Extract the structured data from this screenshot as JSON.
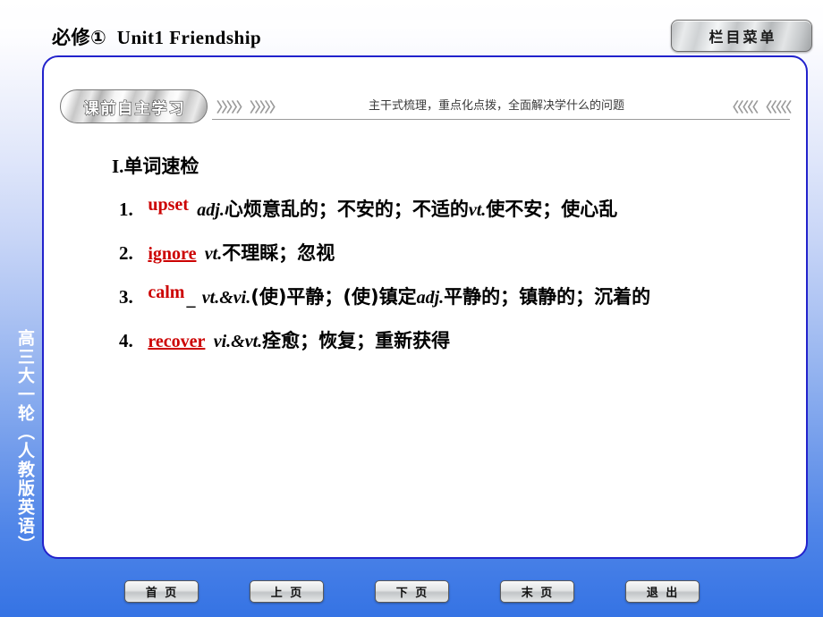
{
  "header": {
    "book_volume": "必修①",
    "unit_title": "Unit1 Friendship",
    "menu_button": "栏目菜单"
  },
  "sidebar": {
    "vertical_label": "高三大一轮（人教版英语）"
  },
  "section": {
    "badge": "课前自主学习",
    "chevrons_left": "〉〉〉〉〉 〉〉〉〉〉",
    "chevrons_right": "〈〈〈〈〈 〈〈〈〈〈",
    "caption": "主干式梳理，重点化点拨，全面解决学什么的问题"
  },
  "content": {
    "heading_num": "I.",
    "heading_text": "单词速检",
    "entries": [
      {
        "index": "1.",
        "word": "upset",
        "underlined": false,
        "blank_tick": "",
        "definition_parts": [
          {
            "type": "pos",
            "text": "adj."
          },
          {
            "type": "cn",
            "text": "心烦意乱的；不安的；不适的"
          },
          {
            "type": "pos",
            "text": "vt."
          },
          {
            "type": "cn",
            "text": "使不安；使心乱"
          }
        ]
      },
      {
        "index": "2.",
        "word": "ignore",
        "underlined": true,
        "blank_tick": "",
        "definition_parts": [
          {
            "type": "pos",
            "text": "vt."
          },
          {
            "type": "cn",
            "text": "不理睬；忽视"
          }
        ]
      },
      {
        "index": "3.",
        "word": "calm",
        "underlined": false,
        "blank_tick": "_",
        "definition_parts": [
          {
            "type": "pos",
            "text": "vt.&vi."
          },
          {
            "type": "cn",
            "text": "(使)平静；(使)镇定"
          },
          {
            "type": "pos",
            "text": "adj."
          },
          {
            "type": "cn",
            "text": "平静的；镇静的；沉着的"
          }
        ]
      },
      {
        "index": "4.",
        "word": "recover",
        "underlined": true,
        "blank_tick": "",
        "definition_parts": [
          {
            "type": "pos",
            "text": "vi.&vt."
          },
          {
            "type": "cn",
            "text": "痊愈；恢复；重新获得"
          }
        ]
      }
    ]
  },
  "footer": {
    "buttons": [
      {
        "label": "首 页",
        "name": "first-page"
      },
      {
        "label": "上 页",
        "name": "previous-page"
      },
      {
        "label": "下 页",
        "name": "next-page"
      },
      {
        "label": "末 页",
        "name": "last-page"
      },
      {
        "label": "退 出",
        "name": "exit"
      }
    ]
  },
  "colors": {
    "background_top": "#ffffff",
    "background_bottom": "#3573e4",
    "panel_border": "#2222cc",
    "word_red": "#cc0000",
    "text_black": "#000000"
  }
}
